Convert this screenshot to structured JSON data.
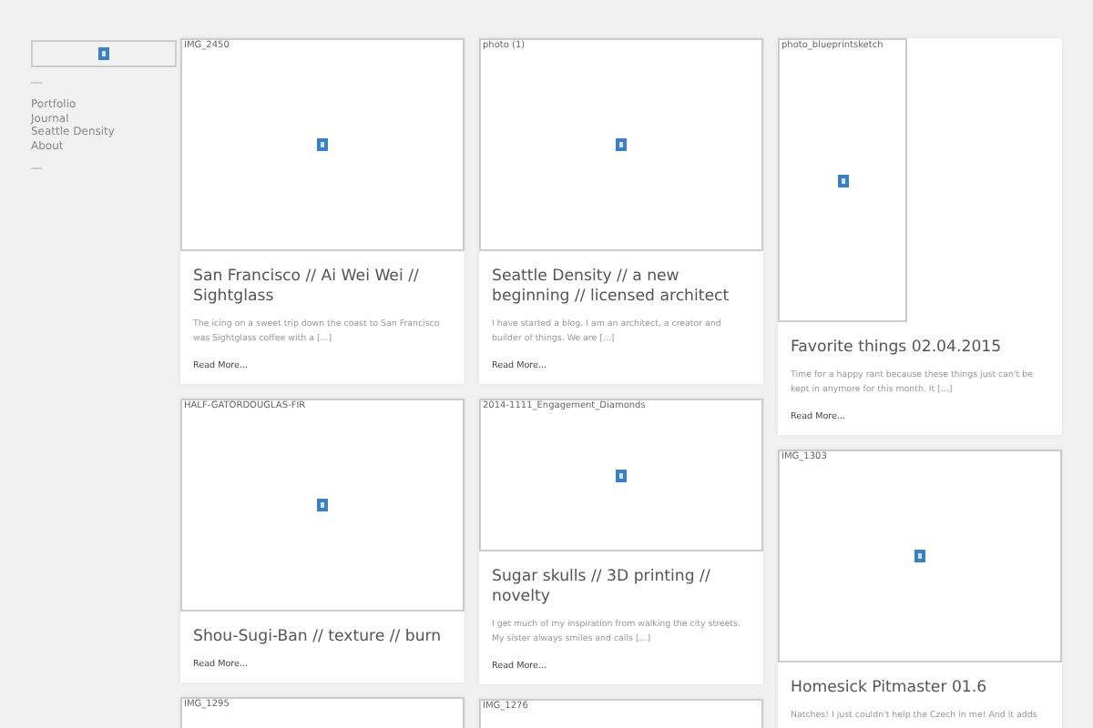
{
  "sidebar": {
    "logo": {
      "kind": "broken-image"
    },
    "menu": [
      "Portfolio",
      "Journal",
      "Seattle Density",
      "About"
    ]
  },
  "columns": [
    [
      {
        "image_alt": "IMG_2450",
        "kind": "landscape",
        "title": "San Francisco // Ai Wei Wei // Sightglass",
        "excerpt": "The icing on a sweet trip down the coast to San Francisco was Sightglass coffee with a [...]",
        "read_more": "Read More..."
      },
      {
        "image_alt": "HALF-GATORDOUGLAS-FIR",
        "kind": "landscape",
        "title": "Shou-Sugi-Ban // texture // burn",
        "read_more": "Read More..."
      },
      {
        "image_alt": "IMG_1295",
        "kind": "landscape"
      }
    ],
    [
      {
        "image_alt": "photo (1)",
        "kind": "landscape",
        "title": "Seattle Density // a new beginning // licensed architect",
        "excerpt": "I have started a blog. I am an architect, a creator and builder of things. We are [...]",
        "read_more": "Read More..."
      },
      {
        "image_alt": "2014-1111_Engagement_Diamonds",
        "kind": "wide",
        "title": "Sugar skulls // 3D printing // novelty",
        "excerpt": "I get much of my inspiration from walking the city streets. My sister always smiles and calls [...]",
        "read_more": "Read More..."
      },
      {
        "image_alt": "IMG_1276",
        "kind": "landscape"
      }
    ],
    [
      {
        "image_alt": "photo_blueprintsketch",
        "kind": "portrait",
        "title": "Favorite things 02.04.2015",
        "excerpt": "Time for a happy rant because these things just can't be kept in anymore for this month.  It [...]",
        "read_more": "Read More..."
      },
      {
        "image_alt": "IMG_1303",
        "kind": "landscape",
        "title": "Homesick Pitmaster 01.6",
        "excerpt": "Natches! I just couldn't help the Czech in me! And it adds"
      }
    ]
  ]
}
